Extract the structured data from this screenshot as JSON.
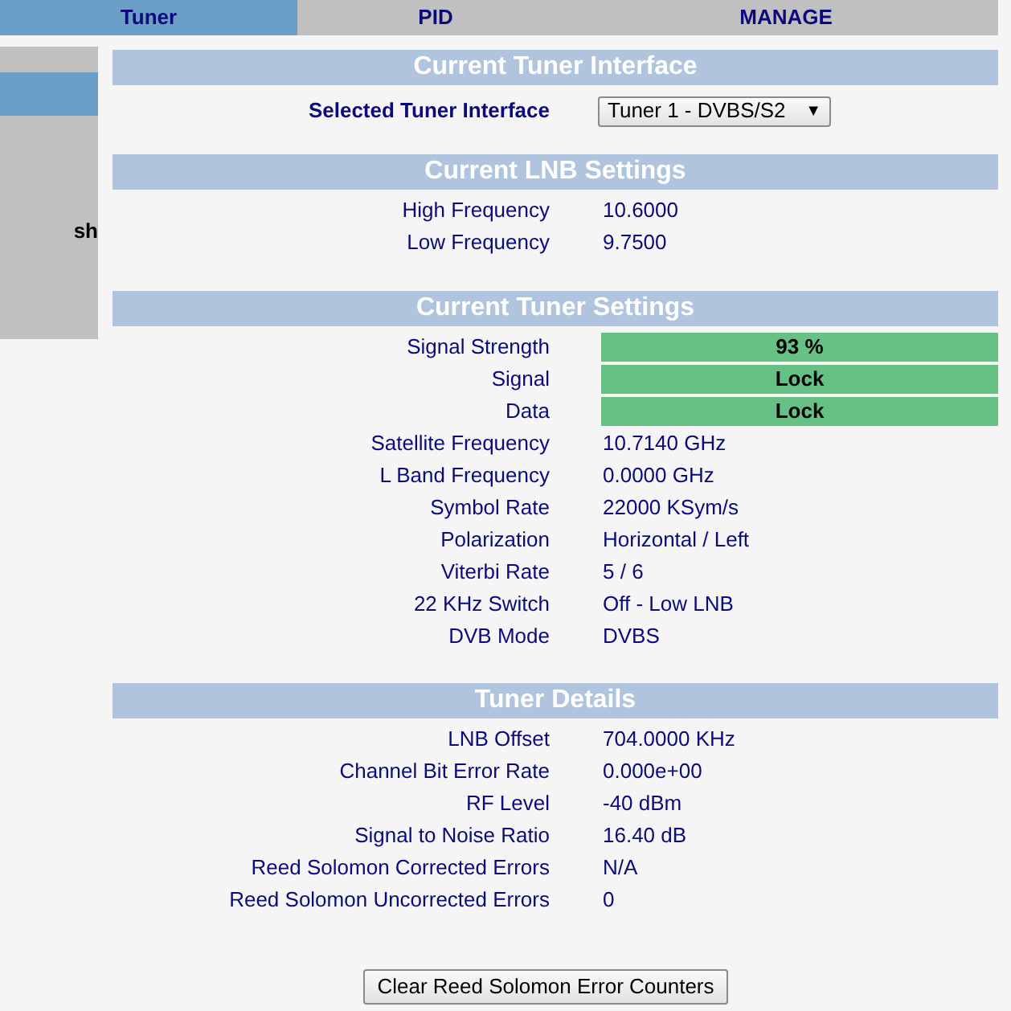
{
  "tabs": [
    {
      "label": "Tuner",
      "selected": true
    },
    {
      "label": "PID",
      "selected": false
    },
    {
      "label": "MANAGE",
      "selected": false
    }
  ],
  "sidebar": {
    "items": [
      {
        "selected": true
      },
      {
        "label": "sh",
        "selected": false
      }
    ]
  },
  "sections": [
    {
      "title": "Current Tuner Interface",
      "select": {
        "label": "Selected Tuner Interface",
        "value": "Tuner 1 - DVBS/S2",
        "arrow": "▼"
      }
    },
    {
      "title": "Current LNB Settings",
      "rows": [
        {
          "kind": "text",
          "label": "High Frequency",
          "value": "10.6000"
        },
        {
          "kind": "text",
          "label": "Low Frequency",
          "value": "9.7500"
        }
      ]
    },
    {
      "title": "Current Tuner Settings",
      "rows": [
        {
          "kind": "status",
          "label": "Signal Strength",
          "value": "93 %"
        },
        {
          "kind": "status",
          "label": "Signal",
          "value": "Lock"
        },
        {
          "kind": "status",
          "label": "Data",
          "value": "Lock"
        },
        {
          "kind": "text",
          "label": "Satellite Frequency",
          "value": "10.7140 GHz"
        },
        {
          "kind": "text",
          "label": "L Band Frequency",
          "value": "0.0000 GHz"
        },
        {
          "kind": "text",
          "label": "Symbol Rate",
          "value": "22000 KSym/s"
        },
        {
          "kind": "text",
          "label": "Polarization",
          "value": "Horizontal / Left"
        },
        {
          "kind": "text",
          "label": "Viterbi Rate",
          "value": "5 / 6"
        },
        {
          "kind": "text",
          "label": "22 KHz Switch",
          "value": "Off - Low LNB"
        },
        {
          "kind": "text",
          "label": "DVB Mode",
          "value": "DVBS"
        }
      ]
    },
    {
      "title": "Tuner Details",
      "rows": [
        {
          "kind": "text",
          "label": "LNB Offset",
          "value": "704.0000 KHz"
        },
        {
          "kind": "text",
          "label": "Channel Bit Error Rate",
          "value": "0.000e+00"
        },
        {
          "kind": "text",
          "label": "RF Level",
          "value": "-40 dBm"
        },
        {
          "kind": "text",
          "label": "Signal to Noise Ratio",
          "value": "16.40 dB"
        },
        {
          "kind": "text",
          "label": "Reed Solomon Corrected Errors",
          "value": "N/A"
        },
        {
          "kind": "text",
          "label": "Reed Solomon Uncorrected Errors",
          "value": "0"
        }
      ]
    }
  ],
  "button": "Clear Reed Solomon Error Counters"
}
